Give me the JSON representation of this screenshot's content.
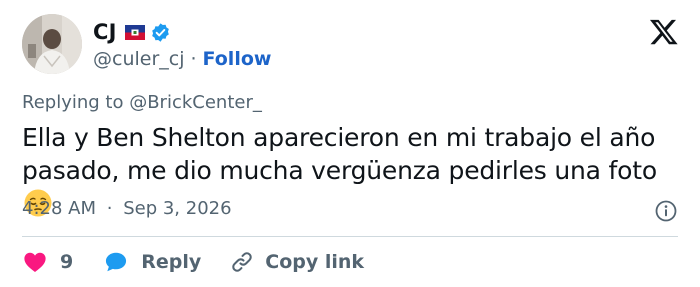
{
  "author": {
    "name": "CJ",
    "handle": "@culer_cj",
    "separator": "·",
    "follow_label": "Follow",
    "flag_icon": "haiti-flag-icon",
    "verified_icon": "verified-badge-icon"
  },
  "brand": {
    "icon": "x-logo-icon"
  },
  "tweet": {
    "replying_to": "Replying to @BrickCenter_",
    "text": "Ella y Ben Shelton aparecieron en mi trabajo el año pasado, me dio mucha vergüenza pedirles una foto",
    "emoji_icon": "pensive-face-emoji",
    "time": "4:28 AM",
    "date_separator": "·",
    "date": "Sep 3, 2026"
  },
  "actions": {
    "like_count": "9",
    "reply_label": "Reply",
    "copy_link_label": "Copy link"
  },
  "colors": {
    "text": "#0f1419",
    "secondary": "#536471",
    "link": "#1d64c9",
    "like": "#f91880",
    "reply": "#1d9bf0",
    "divider": "#cfd9de"
  }
}
